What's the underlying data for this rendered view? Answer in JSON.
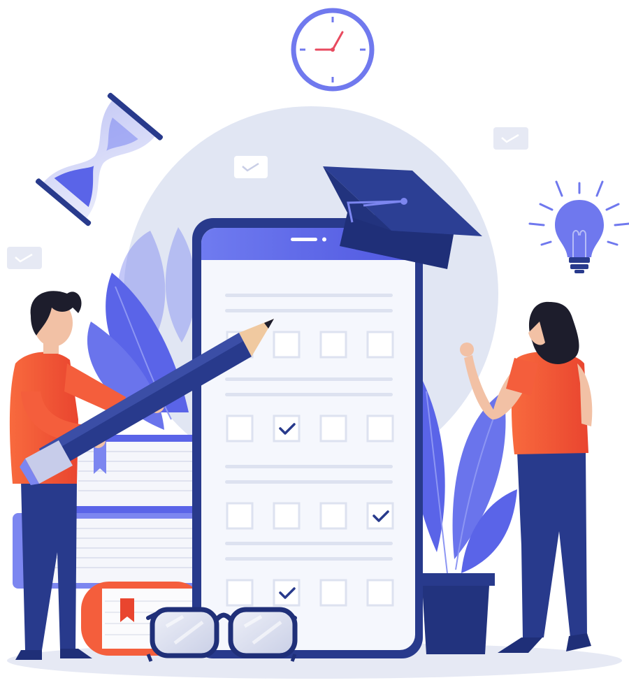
{
  "illustration": {
    "theme": "online-exam",
    "quiz_rows": [
      {
        "checked": -1
      },
      {
        "checked": 1
      },
      {
        "checked": 3
      },
      {
        "checked": 1
      }
    ]
  },
  "colors": {
    "background": "#ffffff",
    "backdrop_circle": "#e2e6f4",
    "brand_blue": "#5a64e8",
    "navy": "#283a8c",
    "dark_navy": "#1f2f78",
    "phone_screen": "#f5f7fd",
    "checkbox_border": "#dde2f0",
    "accent_orange": "#f45e3c",
    "skin": "#f2c1a5",
    "hair": "#1d1d2c",
    "pencil_tip": "#f0c9a0"
  },
  "icons": [
    "clock-icon",
    "hourglass-icon",
    "graduation-cap-icon",
    "lightbulb-icon",
    "pencil-icon",
    "glasses-icon",
    "bookmark-icon",
    "message-bubble-icon"
  ]
}
